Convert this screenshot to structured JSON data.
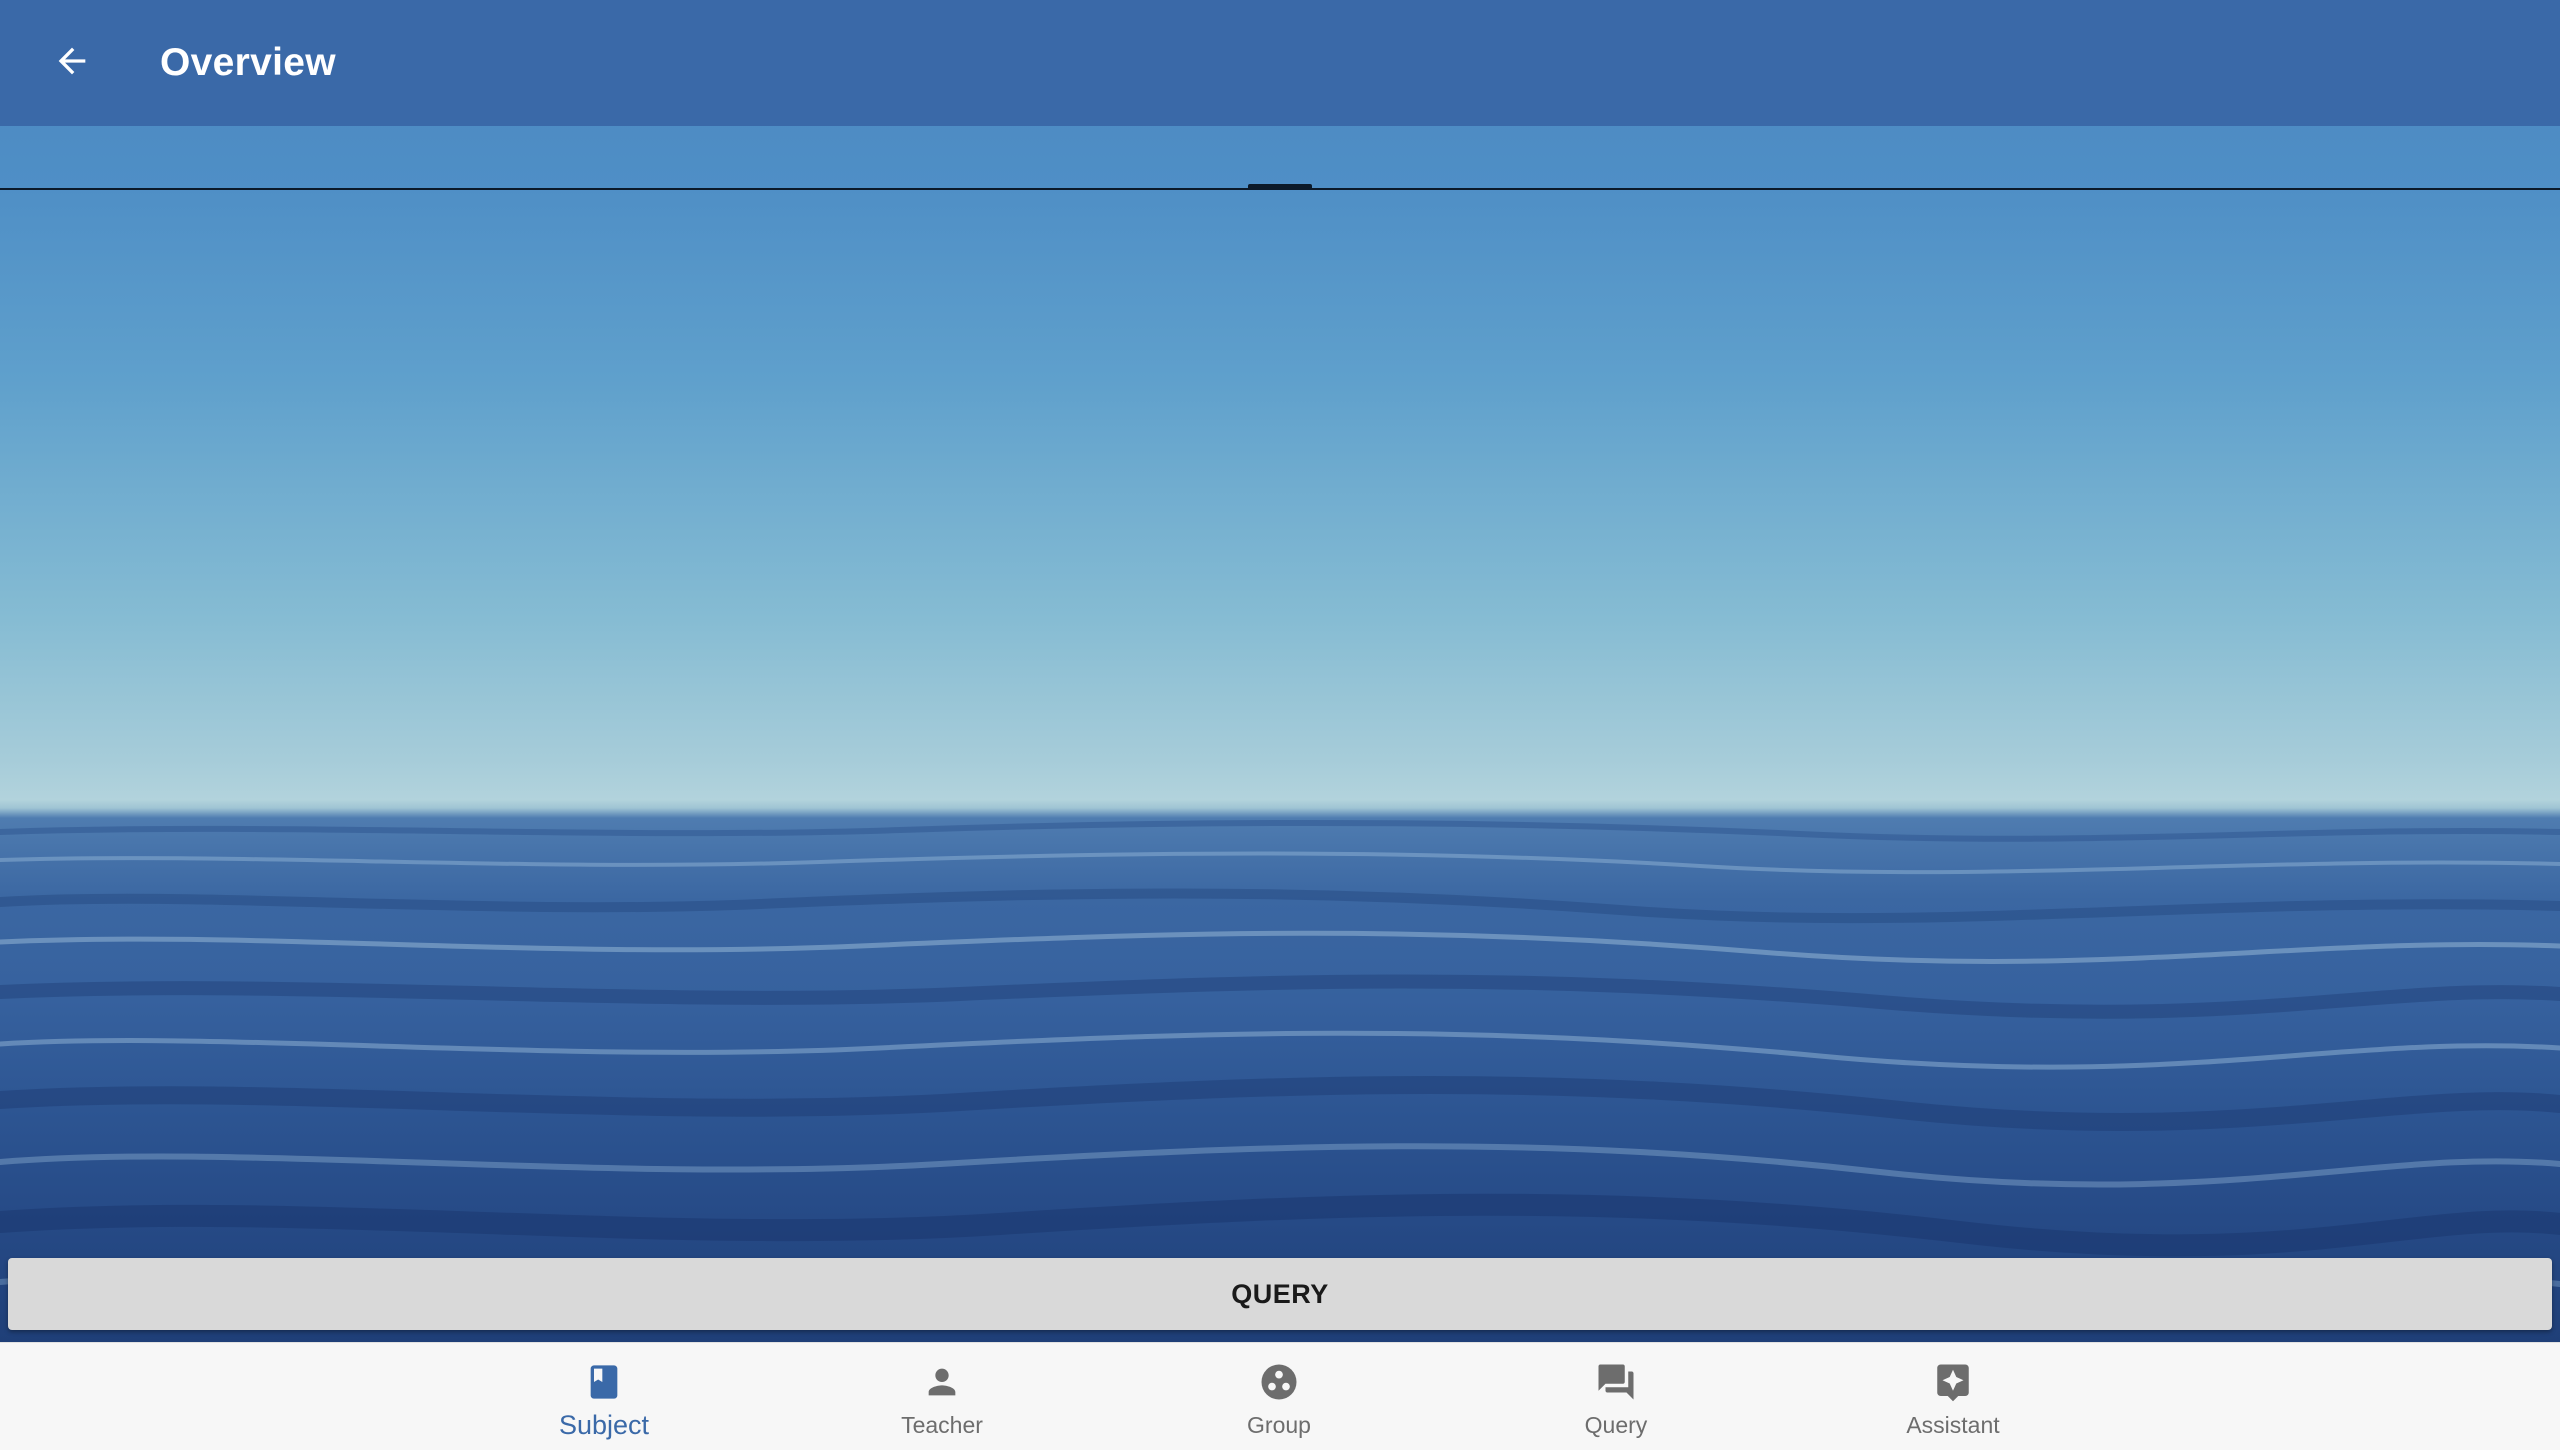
{
  "appbar": {
    "title": "Overview",
    "back_icon": "arrow-back-icon",
    "background_color": "#3a69a8"
  },
  "main": {
    "query_button_label": "QUERY"
  },
  "bottom_nav": {
    "active_color": "#3a69a8",
    "inactive_color": "#6d6d6d",
    "items": [
      {
        "label": "Subject",
        "icon": "book-icon",
        "active": true
      },
      {
        "label": "Teacher",
        "icon": "person-icon",
        "active": false
      },
      {
        "label": "Group",
        "icon": "group-icon",
        "active": false
      },
      {
        "label": "Query",
        "icon": "chat-icon",
        "active": false
      },
      {
        "label": "Assistant",
        "icon": "assistant-icon",
        "active": false
      }
    ]
  }
}
